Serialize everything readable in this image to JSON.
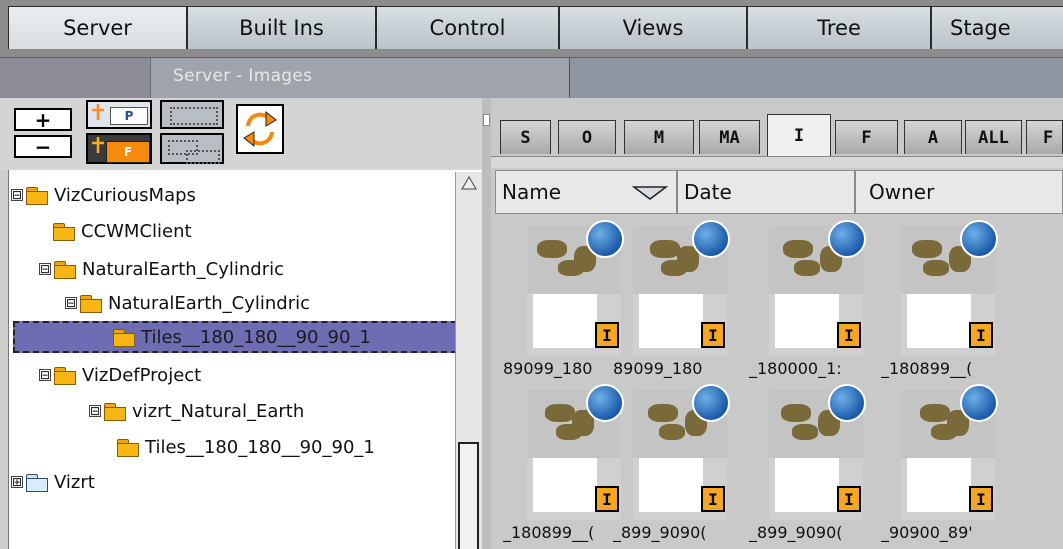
{
  "top_tabs": [
    {
      "label": "Server",
      "active": true
    },
    {
      "label": "Built Ins",
      "active": false
    },
    {
      "label": "Control",
      "active": false
    },
    {
      "label": "Views",
      "active": false
    },
    {
      "label": "Tree",
      "active": false
    },
    {
      "label": "Stage",
      "active": false
    }
  ],
  "dropdown": {
    "label": "Server - Images"
  },
  "toolbar": {
    "plus": "+",
    "minus": "−",
    "add_project": "P",
    "add_folder": "F"
  },
  "tree": [
    {
      "label": "VizCuriousMaps",
      "expander": "⊟",
      "icon": "folder-open-icon",
      "selected": false
    },
    {
      "label": "CCWMClient",
      "expander": "",
      "icon": "folder-icon",
      "selected": false
    },
    {
      "label": "NaturalEarth_Cylindric",
      "expander": "⊟",
      "icon": "folder-open-icon",
      "selected": false
    },
    {
      "label": "NaturalEarth_Cylindric",
      "expander": "⊟",
      "icon": "folder-open-icon",
      "selected": false
    },
    {
      "label": "Tiles__180_180__90_90_1",
      "expander": "",
      "icon": "folder-icon",
      "selected": true
    },
    {
      "label": "VizDefProject",
      "expander": "⊟",
      "icon": "folder-open-icon",
      "selected": false
    },
    {
      "label": "vizrt_Natural_Earth",
      "expander": "⊟",
      "icon": "folder-open-icon",
      "selected": false
    },
    {
      "label": "Tiles__180_180__90_90_1",
      "expander": "",
      "icon": "folder-icon",
      "selected": false
    },
    {
      "label": "Vizrt",
      "expander": "⊞",
      "icon": "folder-blue-icon",
      "selected": false
    }
  ],
  "filter_tabs": [
    {
      "label": "S",
      "active": false
    },
    {
      "label": "O",
      "active": false
    },
    {
      "label": "M",
      "active": false
    },
    {
      "label": "MA",
      "active": false
    },
    {
      "label": "I",
      "active": true
    },
    {
      "label": "F",
      "active": false
    },
    {
      "label": "A",
      "active": false
    },
    {
      "label": "ALL",
      "active": false
    },
    {
      "label": "F",
      "active": false
    }
  ],
  "columns": {
    "name": "Name",
    "date": "Date",
    "owner": "Owner"
  },
  "thumbnails": [
    {
      "caption": "89099_180",
      "badge": "I"
    },
    {
      "caption": "89099_180",
      "badge": "I"
    },
    {
      "caption": "_180000_1:",
      "badge": "I"
    },
    {
      "caption": "_180899__(",
      "badge": "I"
    },
    {
      "caption": "_180899__(",
      "badge": "I"
    },
    {
      "caption": "_899_9090(",
      "badge": "I"
    },
    {
      "caption": "_899_9090(",
      "badge": "I"
    },
    {
      "caption": "_90900_89'",
      "badge": "I"
    }
  ],
  "colors": {
    "folder": "#f7b614",
    "badge": "#f5a623",
    "selection": "#6e6db3",
    "add_icon": "#f58a0b"
  }
}
